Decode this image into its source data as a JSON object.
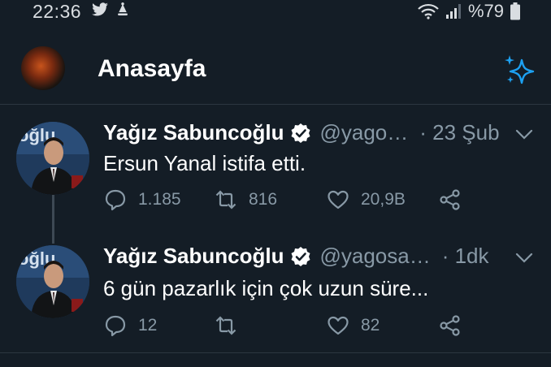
{
  "status_bar": {
    "time": "22:36",
    "battery_text": "%79",
    "icons": [
      "twitter-icon",
      "notification-icon",
      "wifi-icon",
      "signal-icon",
      "battery-icon"
    ]
  },
  "header": {
    "title": "Anasayfa",
    "icons": [
      "profile-avatar",
      "sparkle-icon"
    ],
    "accent_color": "#1da1f2"
  },
  "tweets": [
    {
      "author": "Yağız Sabuncoğlu",
      "handle": "@yago…",
      "time": "· 23 Şub",
      "text": "Ersun Yanal istifa etti.",
      "replies": "1.185",
      "retweets": "816",
      "likes": "20,9B"
    },
    {
      "author": "Yağız Sabuncoğlu",
      "handle": "@yagosa…",
      "time": "· 1dk",
      "text": "6 gün pazarlık için çok uzun süre...",
      "replies": "12",
      "retweets": "",
      "likes": "82"
    }
  ],
  "colors": {
    "background": "#141d26",
    "secondary_text": "#8899a6",
    "divider": "#2c3640"
  }
}
